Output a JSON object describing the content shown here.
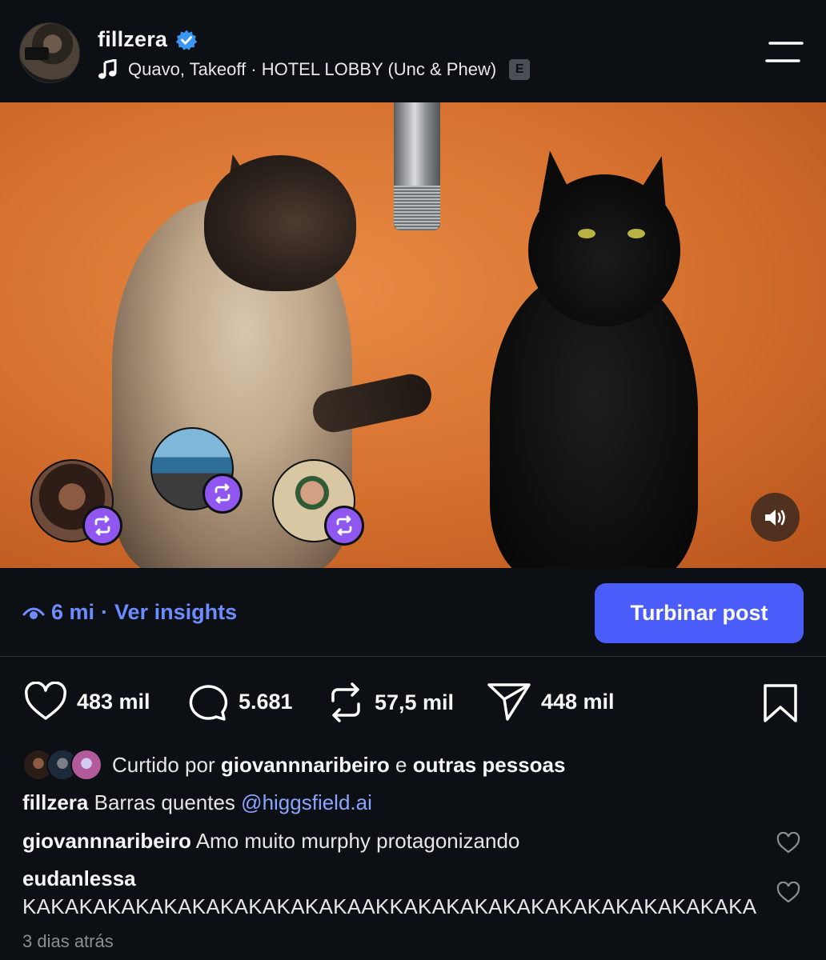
{
  "header": {
    "username": "fillzera",
    "verified": true,
    "music": "Quavo, Takeoff · HOTEL LOBBY (Unc & Phew)",
    "explicit_badge": "E"
  },
  "media": {
    "sound_icon": "speaker-icon",
    "reposters_count_shown": 3
  },
  "insights": {
    "views": "6 mi",
    "separator": "·",
    "link": "Ver insights",
    "boost_button": "Turbinar post"
  },
  "actions": {
    "likes": "483 mil",
    "comments": "5.681",
    "reposts": "57,5 mil",
    "shares": "448 mil"
  },
  "liked_by": {
    "prefix": "Curtido por",
    "user": "giovannnaribeiro",
    "conjunction": "e",
    "others": "outras pessoas"
  },
  "caption": {
    "user": "fillzera",
    "text": "Barras quentes",
    "mention": "@higgsfield.ai"
  },
  "comments": [
    {
      "user": "giovannnaribeiro",
      "text": "Amo muito murphy protagonizando"
    },
    {
      "user": "eudanlessa",
      "text": "KAKAKAKAKAKAKAKAKAKAKAKAAKKAKAKAKAKAKAKAKAKAKAKAKAKA"
    }
  ],
  "timestamp": "3 dias atrás",
  "colors": {
    "background": "#0c1014",
    "accent_blue": "#4a5dfb",
    "link_blue": "#6c8cff",
    "repost_purple": "#8f57f0",
    "verified_blue": "#3897f0"
  }
}
